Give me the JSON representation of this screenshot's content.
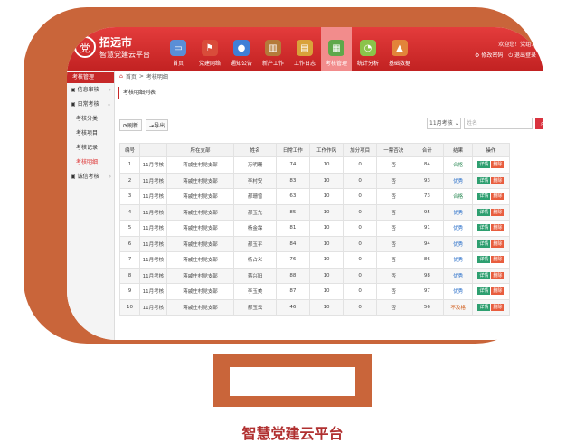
{
  "header": {
    "city": "招远市",
    "subtitle": "智慧党建云平台",
    "welcome": "欢迎您！党组...",
    "modify_password": "修改密码",
    "logout": "退出登录",
    "logo_glyph": "党"
  },
  "nav": [
    {
      "label": "首页",
      "icon": "monitor-icon",
      "color": "#5a8ed6",
      "active": false
    },
    {
      "label": "党建网络",
      "icon": "party-flag-icon",
      "color": "#d94c3a",
      "active": false
    },
    {
      "label": "通知公告",
      "icon": "chat-bubble-icon",
      "color": "#3f7fd6",
      "active": false
    },
    {
      "label": "新产工作",
      "icon": "building-icon",
      "color": "#b57a3a",
      "active": false
    },
    {
      "label": "工作日志",
      "icon": "notebook-icon",
      "color": "#d9a23a",
      "active": false
    },
    {
      "label": "考核管理",
      "icon": "clipboard-icon",
      "color": "#5fa84a",
      "active": true
    },
    {
      "label": "统计分析",
      "icon": "chart-circle-icon",
      "color": "#8bc34a",
      "active": false
    },
    {
      "label": "基础数据",
      "icon": "database-icon",
      "color": "#e2843a",
      "active": false
    }
  ],
  "sidebar": {
    "header": "考核管理",
    "groups": [
      {
        "label": "信息审核",
        "sub": []
      },
      {
        "label": "日常考核",
        "sub": [
          "考核分类",
          "考核项目",
          "考核记录",
          "考核明细"
        ]
      },
      {
        "label": "诚信考核",
        "sub": []
      }
    ],
    "active_sub": "考核明细"
  },
  "breadcrumb": {
    "home": "首页",
    "current": "考核明细"
  },
  "panel": {
    "title": "考核明细列表",
    "refresh": "刷新",
    "export": "导出",
    "month_select": "11月考核",
    "search_placeholder": "姓名"
  },
  "table": {
    "headers": [
      "编号",
      "",
      "所在支部",
      "姓名",
      "日常工作",
      "工作作风",
      "加分项目",
      "一票否决",
      "合计",
      "结果",
      "操作"
    ],
    "detail_label": "详情",
    "delete_label": "删除",
    "rows": [
      [
        "1",
        "11月考核",
        "蒋戚庄村党支部",
        "万明珊",
        "74",
        "10",
        "0",
        "否",
        "84",
        "合格"
      ],
      [
        "2",
        "11月考核",
        "蒋戚庄村党支部",
        "李村安",
        "83",
        "10",
        "0",
        "否",
        "93",
        "优秀"
      ],
      [
        "3",
        "11月考核",
        "蒋戚庄村党支部",
        "郝珊曾",
        "63",
        "10",
        "0",
        "否",
        "73",
        "合格"
      ],
      [
        "4",
        "11月考核",
        "蒋戚庄村党支部",
        "郝玉先",
        "85",
        "10",
        "0",
        "否",
        "95",
        "优秀"
      ],
      [
        "5",
        "11月考核",
        "蒋戚庄村党支部",
        "杨金霖",
        "81",
        "10",
        "0",
        "否",
        "91",
        "优秀"
      ],
      [
        "6",
        "11月考核",
        "蒋戚庄村党支部",
        "郝玉平",
        "84",
        "10",
        "0",
        "否",
        "94",
        "优秀"
      ],
      [
        "7",
        "11月考核",
        "蒋戚庄村党支部",
        "杨占义",
        "76",
        "10",
        "0",
        "否",
        "86",
        "优秀"
      ],
      [
        "8",
        "11月考核",
        "蒋戚庄村党支部",
        "蒋兴阳",
        "88",
        "10",
        "0",
        "否",
        "98",
        "优秀"
      ],
      [
        "9",
        "11月考核",
        "蒋戚庄村党支部",
        "李玉美",
        "87",
        "10",
        "0",
        "否",
        "97",
        "优秀"
      ],
      [
        "10",
        "11月考核",
        "蒋戚庄村党支部",
        "郝玉云",
        "46",
        "10",
        "0",
        "否",
        "56",
        "不及格"
      ]
    ]
  },
  "caption": "智慧党建云平台",
  "colors": {
    "frame": "#c9653a",
    "header_red": "#c22222",
    "accent": "#d9333f"
  }
}
